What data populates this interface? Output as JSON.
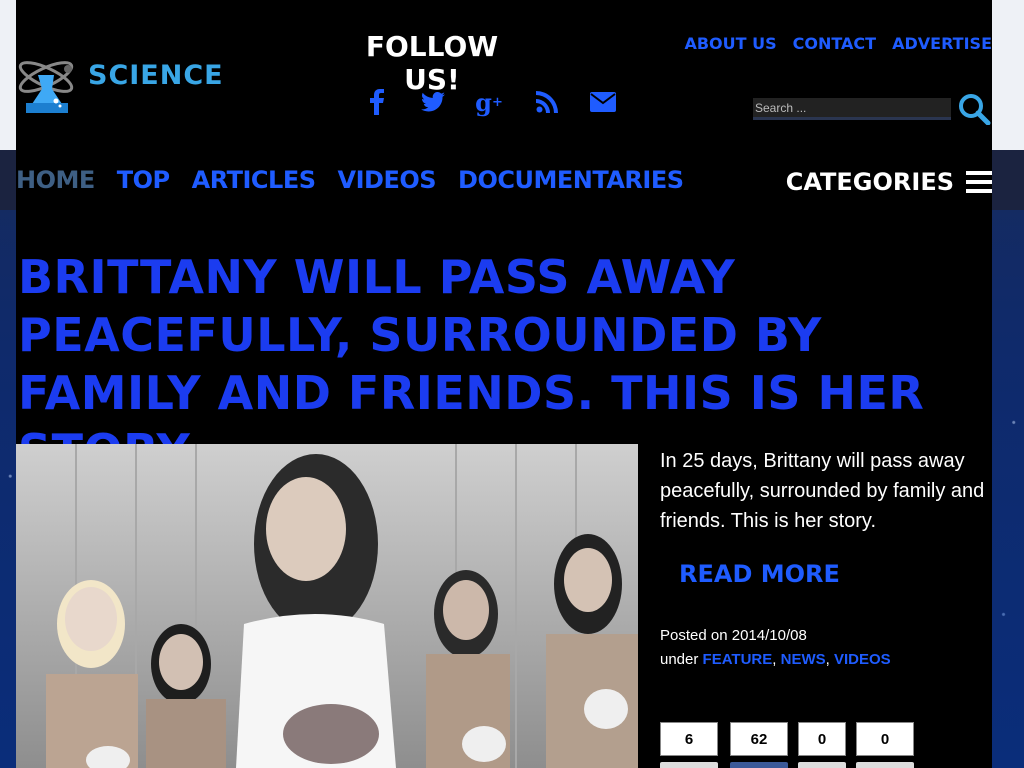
{
  "brand": {
    "name": "SCIENCE"
  },
  "header": {
    "follow_label": "FOLLOW US!",
    "social_icons": [
      "facebook-icon",
      "twitter-icon",
      "google-plus-icon",
      "rss-icon",
      "email-icon"
    ],
    "top_links": [
      "ABOUT US",
      "CONTACT",
      "ADVERTISE"
    ],
    "search": {
      "placeholder": "Search ...",
      "value": ""
    }
  },
  "nav": {
    "items": [
      "HOME",
      "TOP",
      "ARTICLES",
      "VIDEOS",
      "DOCUMENTARIES"
    ],
    "active": "HOME",
    "categories_label": "CATEGORIES"
  },
  "article": {
    "title": "BRITTANY WILL PASS AWAY PEACEFULLY, SURROUNDED BY FAMILY AND FRIENDS. THIS IS HER STORY.",
    "excerpt": "In 25 days, Brittany will pass away peacefully, surrounded by family and friends. This is her story.",
    "read_more": "READ MORE",
    "posted_prefix": "Posted on",
    "date": "2014/10/08",
    "under_prefix": "under",
    "tags": [
      "FEATURE",
      "NEWS",
      "VIDEOS"
    ],
    "share_counts": [
      "6",
      "62",
      "0",
      "0"
    ]
  },
  "colors": {
    "accent": "#1f5cff",
    "title": "#1b3cf0",
    "logo": "#39a6e6"
  }
}
